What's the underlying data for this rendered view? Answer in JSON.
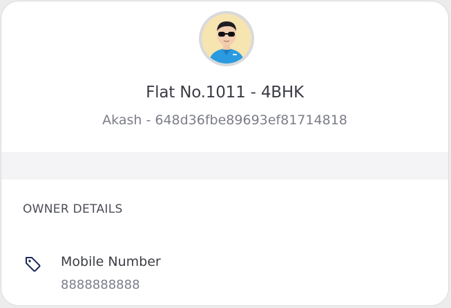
{
  "flat": {
    "title": "Flat No.1011 - 4BHK",
    "subtitle": "Akash - 648d36fbe89693ef81714818"
  },
  "owner_section": {
    "header": "OWNER DETAILS",
    "items": [
      {
        "icon": "tag-icon",
        "label": "Mobile Number",
        "value": "8888888888"
      }
    ]
  },
  "colors": {
    "card_bg": "#ffffff",
    "band_bg": "#f4f4f6",
    "title_text": "#3b3c44",
    "muted_text": "#7b7d88",
    "icon_color": "#1b2a5a"
  }
}
